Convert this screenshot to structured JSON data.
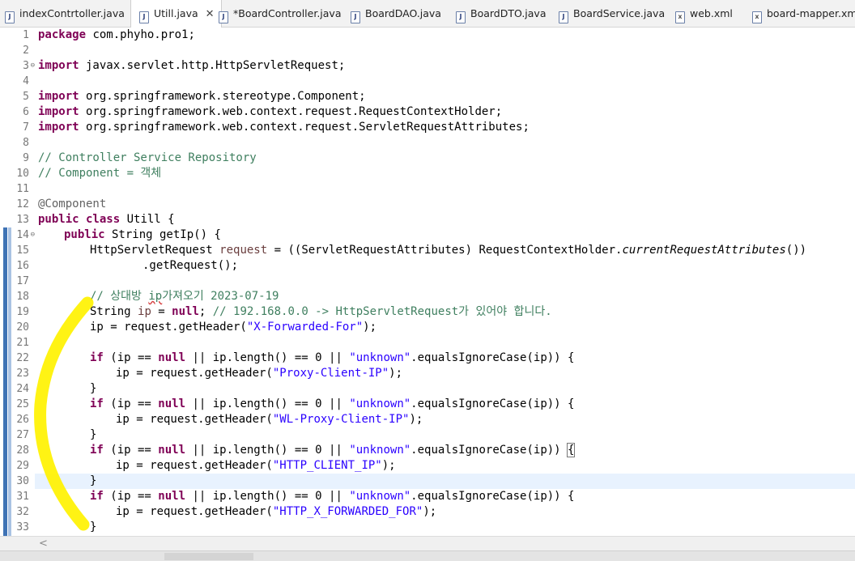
{
  "tabs": [
    {
      "label": "indexContrtoller.java",
      "icon": "java-file-icon",
      "active": false
    },
    {
      "label": "Utill.java",
      "icon": "java-file-icon",
      "active": true
    },
    {
      "label": "*BoardController.java",
      "icon": "java-file-icon",
      "active": false
    },
    {
      "label": "BoardDAO.java",
      "icon": "java-file-icon",
      "active": false
    },
    {
      "label": "BoardDTO.java",
      "icon": "java-file-icon",
      "active": false
    },
    {
      "label": "BoardService.java",
      "icon": "java-file-icon",
      "active": false
    },
    {
      "label": "web.xml",
      "icon": "xml-file-icon",
      "active": false
    },
    {
      "label": "board-mapper.xml",
      "icon": "xml-file-icon",
      "active": false
    }
  ],
  "editor": {
    "line_numbers": [
      "1",
      "2",
      "3",
      "4",
      "5",
      "6",
      "7",
      "8",
      "9",
      "10",
      "11",
      "12",
      "13",
      "14",
      "15",
      "16",
      "17",
      "18",
      "19",
      "20",
      "21",
      "22",
      "23",
      "24",
      "25",
      "26",
      "27",
      "28",
      "29",
      "30",
      "31",
      "32",
      "33"
    ],
    "code": {
      "l1_kw": "package",
      "l1_rest": " com.phyho.pro1;",
      "l3_kw": "import",
      "l3_rest": " javax.servlet.http.HttpServletRequest;",
      "l5_kw": "import",
      "l5_rest": " org.springframework.stereotype.Component;",
      "l6_kw": "import",
      "l6_rest": " org.springframework.web.context.request.RequestContextHolder;",
      "l7_kw": "import",
      "l7_rest": " org.springframework.web.context.request.ServletRequestAttributes;",
      "l9": "// Controller Service Repository",
      "l10": "// Component = 객체",
      "l12": "@Component",
      "l13_kw": "public class",
      "l13_rest": " Utill {",
      "l14_kw": "public",
      "l14_rest": " String getIp() {",
      "l15_a": "HttpServletRequest ",
      "l15_var": "request",
      "l15_b": " = ((ServletRequestAttributes) RequestContextHolder.",
      "l15_it": "currentRequestAttributes",
      "l15_c": "())",
      ".": ".",
      "l16": ".getRequest();",
      "l18_a": "// 상대방 ",
      "l18_sq": "ip",
      "l18_b": "가져오기 2023-07-19",
      "l19_a": "String ",
      "l19_var": "ip",
      "l19_b": " = ",
      "l19_kw": "null",
      "l19_c": "; ",
      "l19_cm": "// 192.168.0.0 -> HttpServletRequest가 있어야 합니다.",
      "l20_a": "ip = request.getHeader(",
      "l20_s": "\"X-Forwarded-For\"",
      "l20_b": ");",
      "if_kw": "if",
      "null_kw": "null",
      "cond_a": " (ip == ",
      "cond_b": " || ip.length() == 0 || ",
      "unknown_s": "\"unknown\"",
      "cond_c": ".equalsIgnoreCase(ip)) {",
      "cond_c28": ".equalsIgnoreCase(ip)) ",
      "brace_open": "{",
      "get_a": "ip = request.getHeader(",
      "get_end": ");",
      "h23": "\"Proxy-Client-IP\"",
      "h26": "\"WL-Proxy-Client-IP\"",
      "h29": "\"HTTP_CLIENT_IP\"",
      "h32": "\"HTTP_X_FORWARDED_FOR\"",
      "close": "}"
    }
  },
  "scrollbar": {
    "left_arrow": "<"
  },
  "colors": {
    "keyword": "#7f0055",
    "string": "#2a00ff",
    "comment": "#3f7f5f",
    "annotation": "#646464",
    "marker": "#fff200",
    "current_line": "#e8f2fe"
  }
}
